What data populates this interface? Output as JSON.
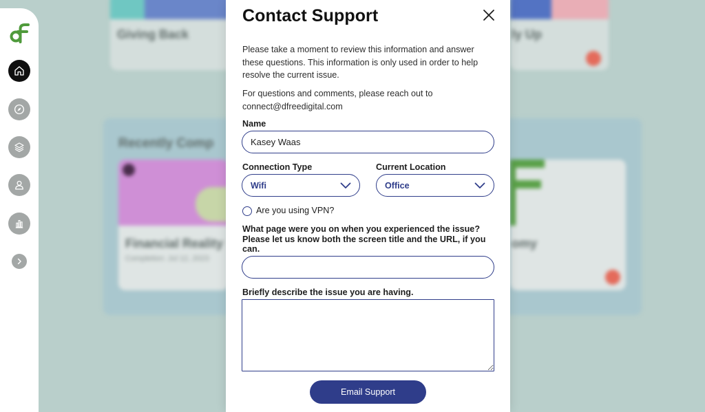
{
  "background": {
    "card1_title": "Giving Back",
    "card2_title_fragment": "ly Up",
    "section_title": "Recently Comp",
    "card3_title": "Financial Reality",
    "card3_subtitle": "Completion: Jul 12, 2023",
    "card4_title_fragment": "omy"
  },
  "sidebar": {
    "logo_icon": "dfree-logo",
    "items": [
      {
        "icon": "home-icon",
        "active": true
      },
      {
        "icon": "compass-icon",
        "active": false
      },
      {
        "icon": "layers-icon",
        "active": false
      },
      {
        "icon": "user-icon",
        "active": false
      },
      {
        "icon": "bar-chart-icon",
        "active": false
      }
    ],
    "expand_icon": "chevron-right-icon"
  },
  "modal": {
    "title": "Contact Support",
    "intro": "Please take a moment to review this information and answer these questions. This information is only used in order to help resolve the current issue.",
    "contact": "For questions and comments, please reach out to connect@dfreedigital.com",
    "name_label": "Name",
    "name_value": "Kasey Waas",
    "connection_label": "Connection Type",
    "connection_value": "Wifi",
    "location_label": "Current Location",
    "location_value": "Office",
    "vpn_label": "Are you using VPN?",
    "page_label": "What page were you on when you experienced the issue? Please let us know both the screen title and the URL, if you can.",
    "page_value": "",
    "issue_label": "Briefly describe the issue you are having.",
    "issue_value": "",
    "submit_label": "Email Support"
  },
  "colors": {
    "accent": "#2f3d8a",
    "logo_green": "#4f9a3b",
    "overlay": "#b9cfcb"
  }
}
